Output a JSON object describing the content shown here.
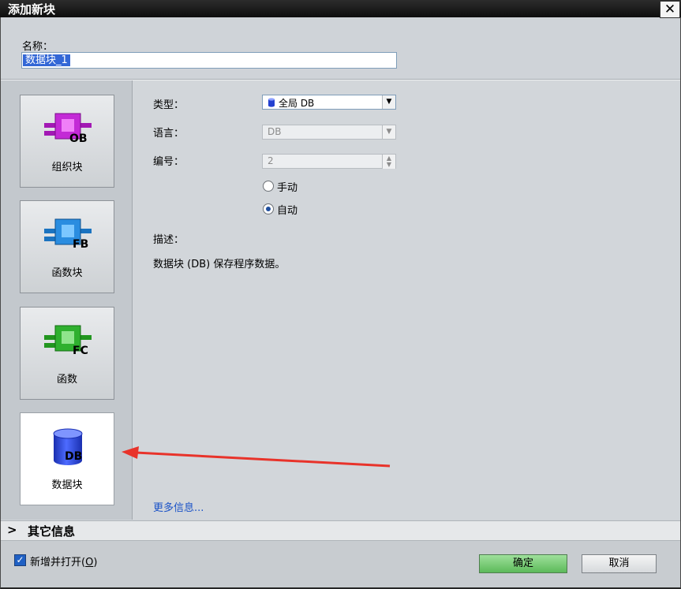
{
  "window": {
    "title": "添加新块",
    "close_glyph": "✕"
  },
  "name": {
    "label": "名称：",
    "value": "数据块_1"
  },
  "block_types": [
    {
      "label": "组织块",
      "tag": "OB",
      "icon": "ob-block-icon",
      "color": "#c020d0"
    },
    {
      "label": "函数块",
      "tag": "FB",
      "icon": "fb-block-icon",
      "color": "#2a8de0"
    },
    {
      "label": "函数",
      "tag": "FC",
      "icon": "fc-block-icon",
      "color": "#2fb02f"
    },
    {
      "label": "数据块",
      "tag": "DB",
      "icon": "db-block-icon",
      "color": "#2040d0"
    }
  ],
  "form": {
    "type_label": "类型：",
    "type_value": "全局 DB",
    "language_label": "语言：",
    "language_value": "DB",
    "number_label": "编号：",
    "number_value": "2",
    "manual_label": "手动",
    "auto_label": "自动",
    "selected_mode": "自动",
    "desc_label": "描述：",
    "desc_text": "数据块 (DB) 保存程序数据。"
  },
  "more_info_link": "更多信息...",
  "other_info": {
    "chevron": ">",
    "label": "其它信息"
  },
  "footer": {
    "checkbox_label": "新增并打开(",
    "checkbox_mnemonic": "O",
    "checkbox_suffix": ")",
    "checkbox_checked": true,
    "ok_label": "确定",
    "cancel_label": "取消"
  },
  "colors": {
    "accent_arrow": "#e8332a",
    "ok_green": "#6fc76c",
    "selection_blue": "#3367d6"
  }
}
